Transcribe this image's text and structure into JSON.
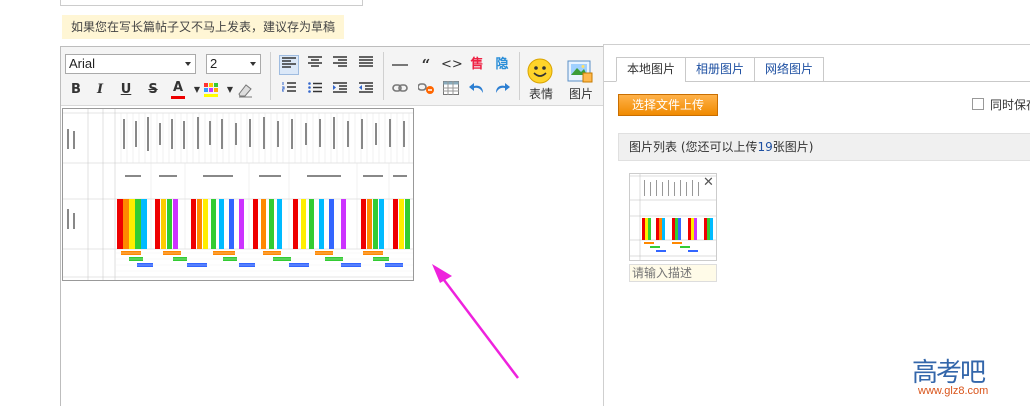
{
  "tip": "如果您在写长篇帖子又不马上发表，建议存为草稿",
  "editor": {
    "font_family": "Arial",
    "font_size": "2",
    "emoticon_label": "表情",
    "image_label": "图片",
    "icons": [
      "bold-icon",
      "italic-icon",
      "underline-icon",
      "strikethrough-icon",
      "font-color-icon",
      "highlight-color-icon",
      "eraser-icon",
      "align-left-icon",
      "align-center-icon",
      "align-right-icon",
      "justify-icon",
      "ordered-list-icon",
      "unordered-list-icon",
      "indent-icon",
      "outdent-icon",
      "horizontal-rule-icon",
      "quote-icon",
      "code-icon",
      "sale-icon",
      "music-icon",
      "link-icon",
      "unlink-icon",
      "table-icon",
      "undo-icon",
      "redo-icon"
    ]
  },
  "panel": {
    "tabs": [
      "本地图片",
      "相册图片",
      "网络图片"
    ],
    "upload_button": "选择文件上传",
    "sync_label": "同时保存",
    "list_prefix": "图片列表 (您还可以上传",
    "list_count": "19",
    "list_suffix": "张图片)",
    "desc_placeholder": "请输入描述"
  },
  "watermark": {
    "chars": "高考吧",
    "url": "www.glz8.com"
  },
  "colors": {
    "accent_orange": "#f08a00",
    "link_blue": "#1e50a2",
    "tip_bg": "#fff6d5",
    "arrow": "#ee22dd"
  }
}
